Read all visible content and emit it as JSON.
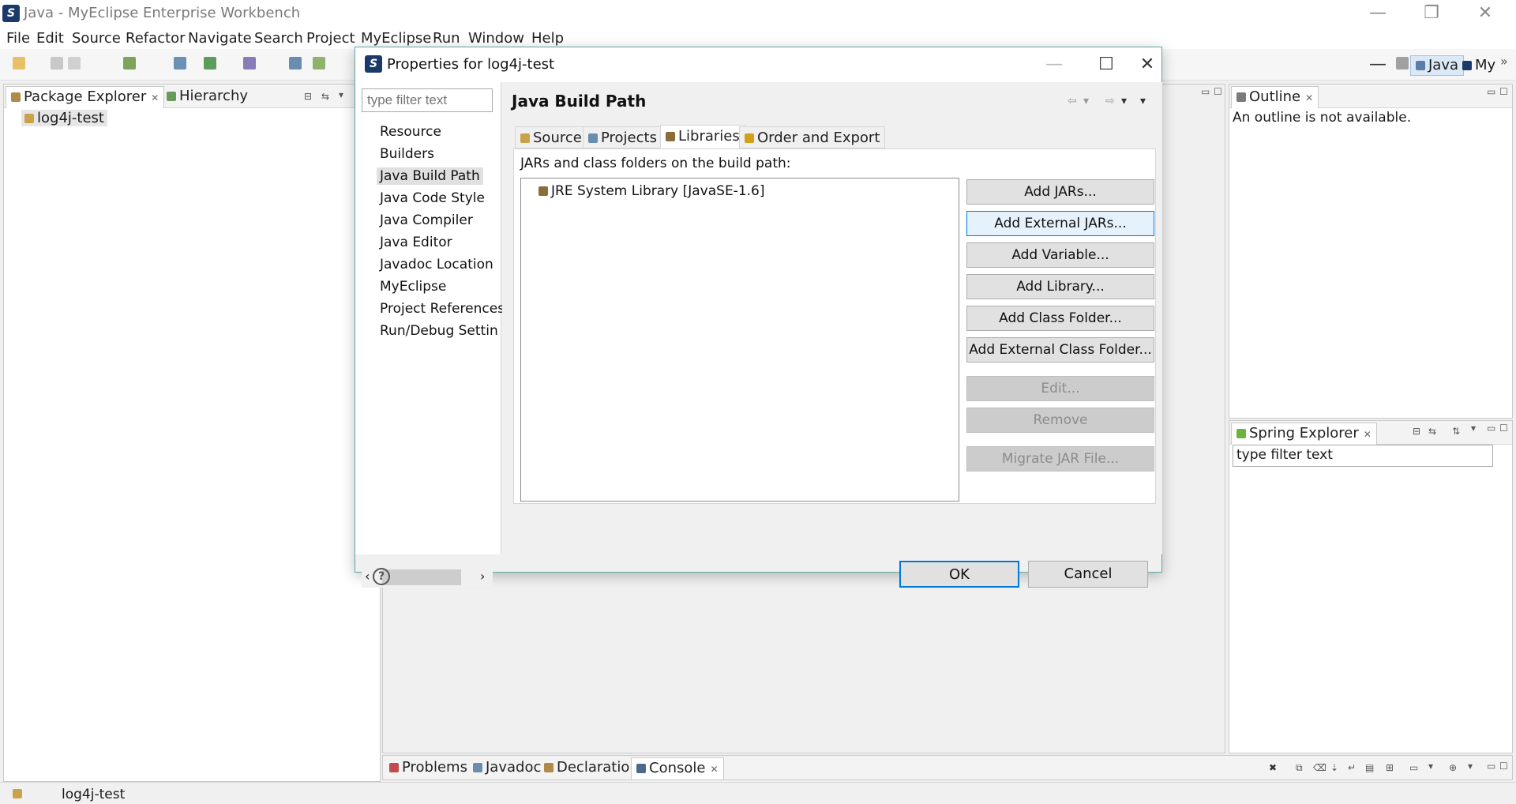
{
  "window": {
    "title": "Java - MyEclipse Enterprise Workbench",
    "minimize": "—",
    "restore": "❐",
    "close": "✕"
  },
  "menu": [
    "File",
    "Edit",
    "Source",
    "Refactor",
    "Navigate",
    "Search",
    "Project",
    "MyEclipse",
    "Run",
    "Window",
    "Help"
  ],
  "perspectives": {
    "java": "Java",
    "my": "My"
  },
  "package_explorer": {
    "tab_label": "Package Explorer",
    "hierarchy_label": "Hierarchy",
    "project": "log4j-test"
  },
  "outline": {
    "tab_label": "Outline",
    "message": "An outline is not available."
  },
  "spring_explorer": {
    "tab_label": "Spring Explorer",
    "filter_value": "type filter text"
  },
  "bottom_panel": {
    "tabs": [
      "Problems",
      "Javadoc",
      "Declaration",
      "Console"
    ]
  },
  "status": {
    "text": "log4j-test"
  },
  "dialog": {
    "title": "Properties for log4j-test",
    "minimize": "—",
    "maximize": "☐",
    "close": "✕",
    "filter_placeholder": "type filter text",
    "nav": [
      "Resource",
      "Builders",
      "Java Build Path",
      "Java Code Style",
      "Java Compiler",
      "Java Editor",
      "Javadoc Location",
      "MyEclipse",
      "Project References",
      "Run/Debug Settin"
    ],
    "selected_nav": "Java Build Path",
    "page_title": "Java Build Path",
    "tabs": [
      "Source",
      "Projects",
      "Libraries",
      "Order and Export"
    ],
    "active_tab": "Libraries",
    "libraries_label": "JARs and class folders on the build path:",
    "libraries": [
      "JRE System Library [JavaSE-1.6]"
    ],
    "buttons": {
      "add_jars": "Add JARs...",
      "add_external_jars": "Add External JARs...",
      "add_variable": "Add Variable...",
      "add_library": "Add Library...",
      "add_class_folder": "Add Class Folder...",
      "add_external_class_folder": "Add External Class Folder...",
      "edit": "Edit...",
      "remove": "Remove",
      "migrate_jar": "Migrate JAR File..."
    },
    "help": "?",
    "ok": "OK",
    "cancel": "Cancel"
  }
}
